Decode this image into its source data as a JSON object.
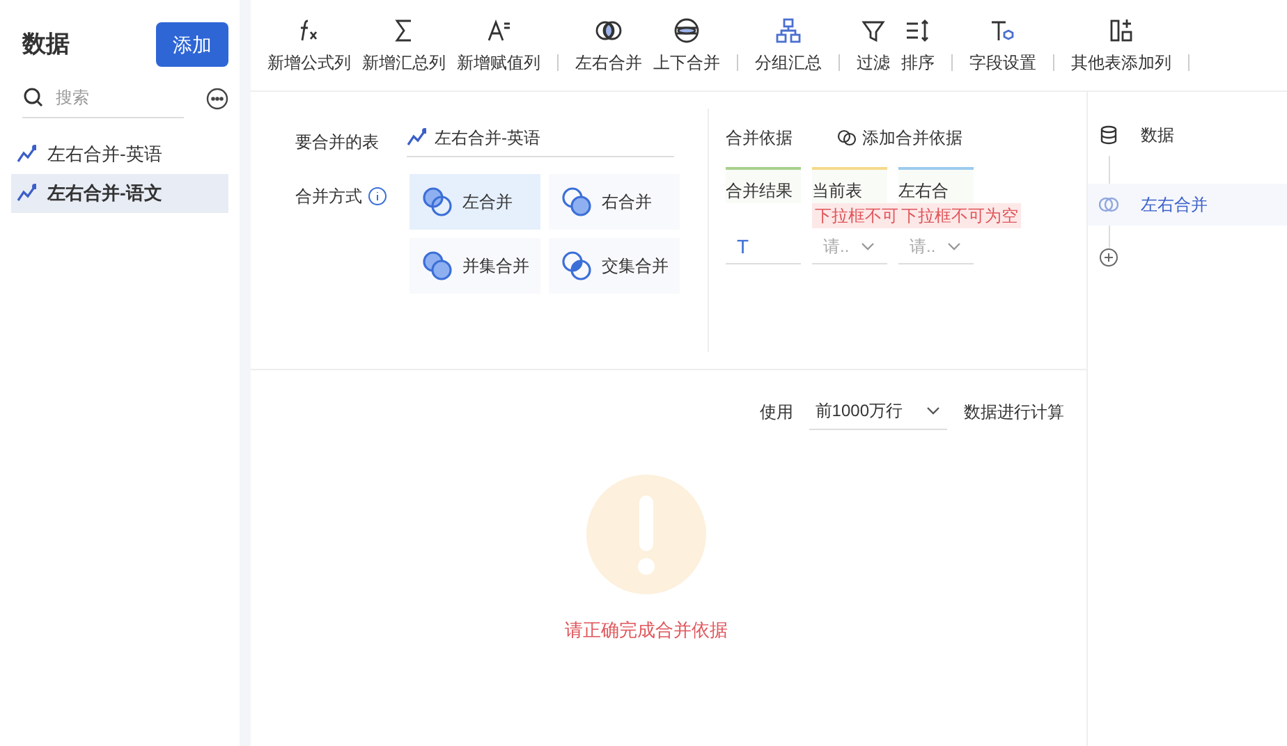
{
  "sidebar": {
    "title": "数据",
    "add_button": "添加",
    "search": {
      "placeholder": "搜索"
    },
    "items": [
      {
        "label": "左右合并-英语",
        "selected": false
      },
      {
        "label": "左右合并-语文",
        "selected": true
      }
    ]
  },
  "toolbar": {
    "groups": [
      [
        {
          "kind": "fx",
          "label": "新增公式列"
        },
        {
          "kind": "sum",
          "label": "新增汇总列"
        },
        {
          "kind": "assign",
          "label": "新增赋值列"
        }
      ],
      [
        {
          "kind": "lr",
          "label": "左右合并"
        },
        {
          "kind": "ud",
          "label": "上下合并"
        }
      ],
      [
        {
          "kind": "group",
          "label": "分组汇总"
        }
      ],
      [
        {
          "kind": "filter",
          "label": "过滤"
        },
        {
          "kind": "sort",
          "label": "排序"
        }
      ],
      [
        {
          "kind": "field",
          "label": "字段设置"
        }
      ],
      [
        {
          "kind": "addcol",
          "label": "其他表添加列"
        }
      ]
    ]
  },
  "merge": {
    "table_label": "要合并的表",
    "table_value": "左右合并-英语",
    "mode_label": "合并方式",
    "modes": [
      {
        "kind": "left",
        "label": "左合并",
        "selected": true
      },
      {
        "kind": "right",
        "label": "右合并",
        "selected": false
      },
      {
        "kind": "union",
        "label": "并集合并",
        "selected": false
      },
      {
        "kind": "inter",
        "label": "交集合并",
        "selected": false
      }
    ]
  },
  "basis": {
    "title": "合并依据",
    "add": "添加合并依据",
    "columns": [
      {
        "header": "合并结果",
        "color": "#a8d08d",
        "value": "T"
      },
      {
        "header": "当前表",
        "color": "#f5d98b",
        "value": "请..",
        "error": "下拉框不可"
      },
      {
        "header": "左右合",
        "color": "#9ccbee",
        "value": "请..",
        "error": "下拉框不可为空"
      }
    ]
  },
  "compute": {
    "prefix": "使用",
    "select": "前1000万行",
    "suffix": "数据进行计算"
  },
  "message": "请正确完成合并依据",
  "flow": {
    "items": [
      {
        "kind": "data",
        "label": "数据",
        "selected": false
      },
      {
        "kind": "merge",
        "label": "左右合并",
        "selected": true
      }
    ]
  }
}
